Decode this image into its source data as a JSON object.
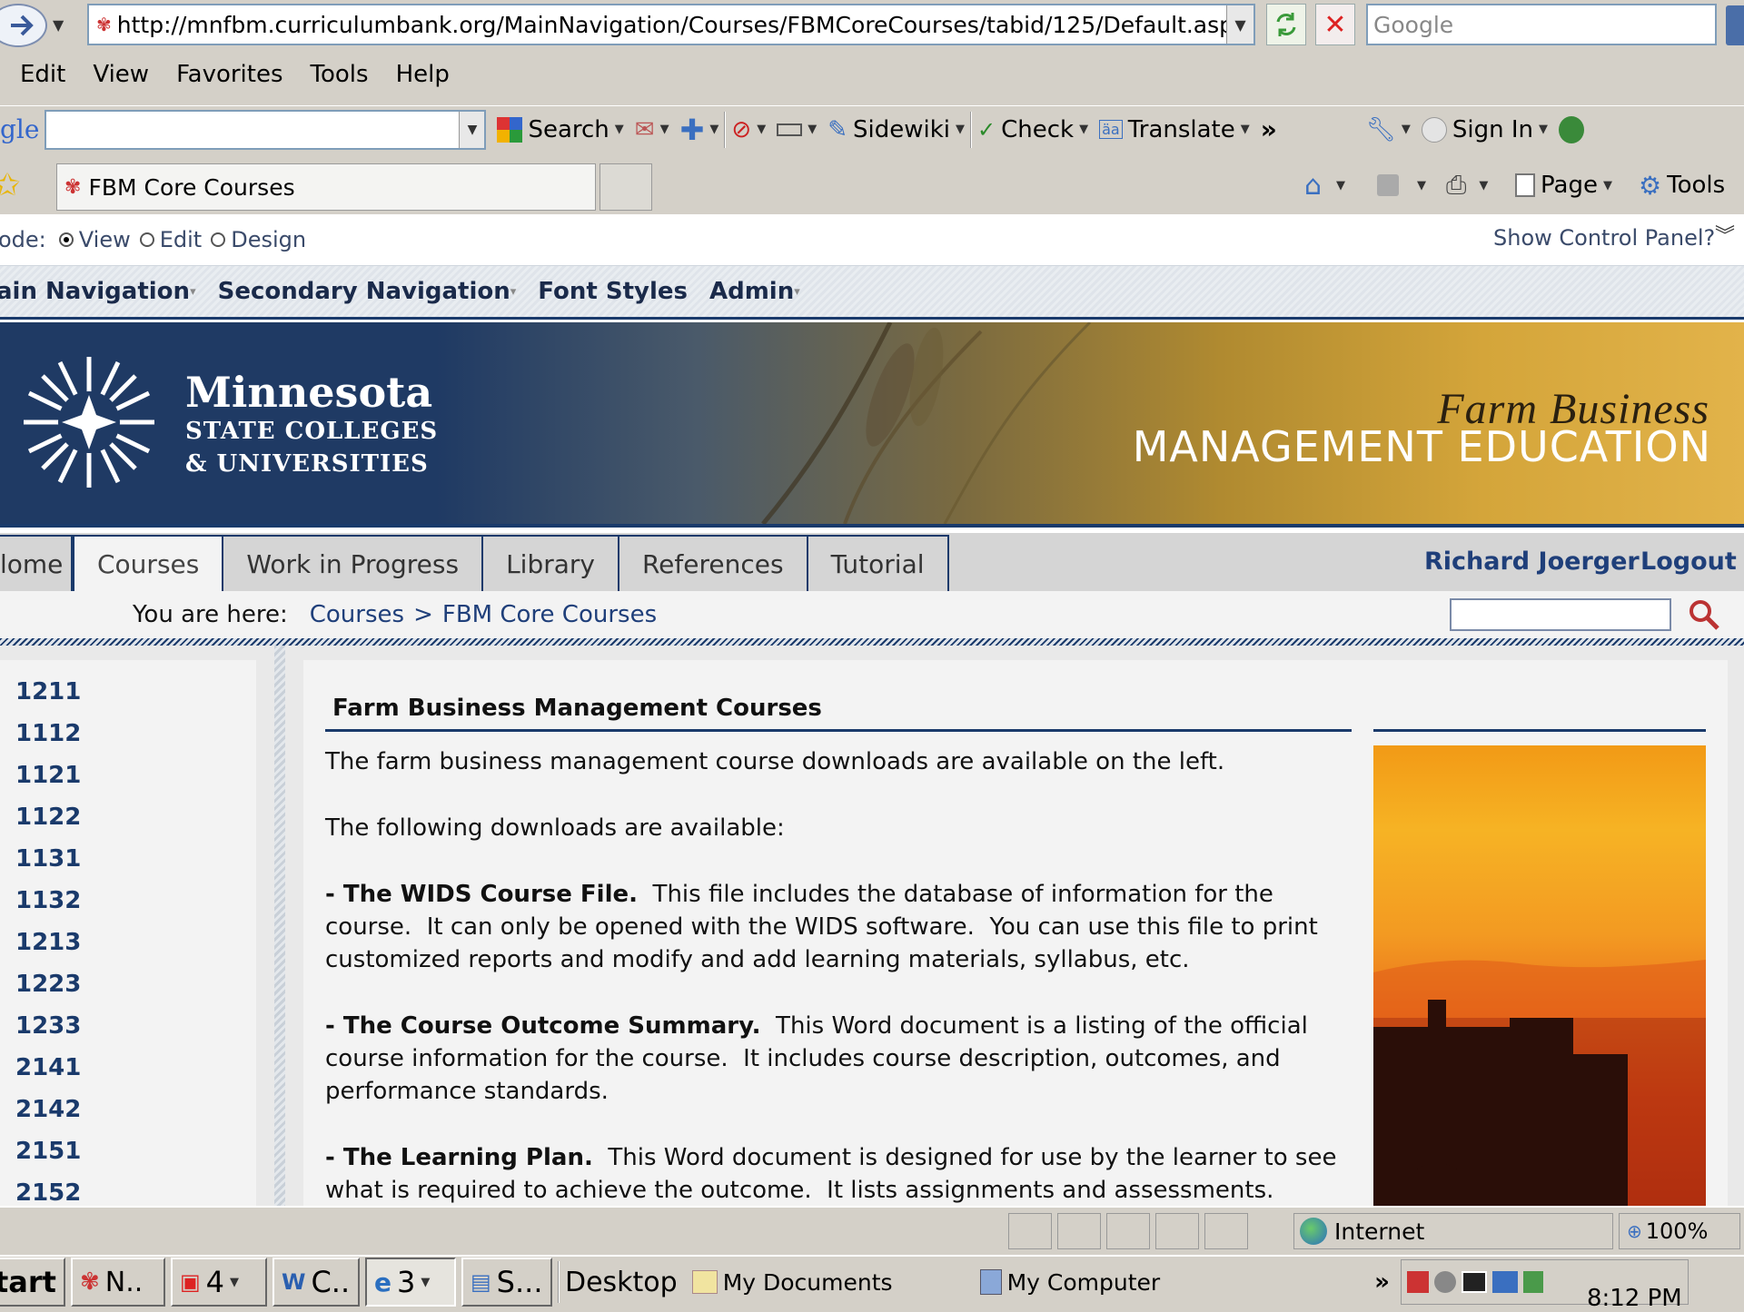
{
  "browser": {
    "url": "http://mnfbm.curriculumbank.org/MainNavigation/Courses/FBMCoreCourses/tabid/125/Default.aspx",
    "search_placeholder": "Google",
    "menu": [
      "Edit",
      "View",
      "Favorites",
      "Tools",
      "Help"
    ],
    "google_toolbar": {
      "logo": "gle",
      "search": "Search",
      "sidewiki": "Sidewiki",
      "check": "Check",
      "translate": "Translate",
      "more": "»",
      "sign_in": "Sign In"
    },
    "tab_title": "FBM Core Courses",
    "command_bar": {
      "page": "Page",
      "tools": "Tools"
    },
    "status": {
      "zone": "Internet",
      "zoom": "100%"
    }
  },
  "dnn": {
    "mode_label": "ode:",
    "modes": [
      "View",
      "Edit",
      "Design"
    ],
    "show_control_panel": "Show Control Panel?",
    "admin_menu": [
      "ain Navigation",
      "Secondary Navigation",
      "Font Styles",
      "Admin"
    ]
  },
  "banner": {
    "logo_line1": "Minnesota",
    "logo_line2": "STATE COLLEGES",
    "logo_line3": "& UNIVERSITIES",
    "title_italic": "Farm Business",
    "title_caps": "MANAGEMENT EDUCATION"
  },
  "site_nav": {
    "tabs": [
      "lome",
      "Courses",
      "Work in Progress",
      "Library",
      "References",
      "Tutorial"
    ],
    "active": "Courses",
    "user": "Richard Joerger",
    "logout": "Logout"
  },
  "breadcrumb": {
    "label": "You are here:",
    "crumb1": "Courses",
    "separator": ">",
    "crumb2": "FBM Core Courses"
  },
  "left_nav": [
    "1211",
    "1112",
    "1121",
    "1122",
    "1131",
    "1132",
    "1213",
    "1223",
    "1233",
    "2141",
    "2142",
    "2151",
    "2152"
  ],
  "content": {
    "heading": "Farm Business Management Courses",
    "p1": "The farm business management course downloads are available on the left.",
    "p2": "The following downloads are available:",
    "p3_bold": "- The WIDS Course File.",
    "p3": "  This file includes the database of information for the course.  It can only be opened with the WIDS software.  You can use this file to print customized reports and modify and add learning materials, syllabus, etc.",
    "p4_bold": "- The Course Outcome Summary.",
    "p4": "  This Word document is a listing of the official course information for the course.  It includes course description, outcomes, and performance standards.",
    "p5_bold": "- The Learning Plan.",
    "p5": "  This Word document is designed for use by the learner to see what is required to achieve the outcome.  It lists assignments and assessments."
  },
  "taskbar": {
    "start": "tart",
    "tasks": [
      "N..",
      "4",
      "C..",
      "3",
      "S..."
    ],
    "desktop": "Desktop",
    "my_documents": "My Documents",
    "my_computer": "My Computer",
    "more": "»",
    "clock": "8:12 PM"
  },
  "colors": {
    "navy": "#1a3a6b",
    "link": "#1f3f7a",
    "banner_bg": "#1f3a64"
  }
}
